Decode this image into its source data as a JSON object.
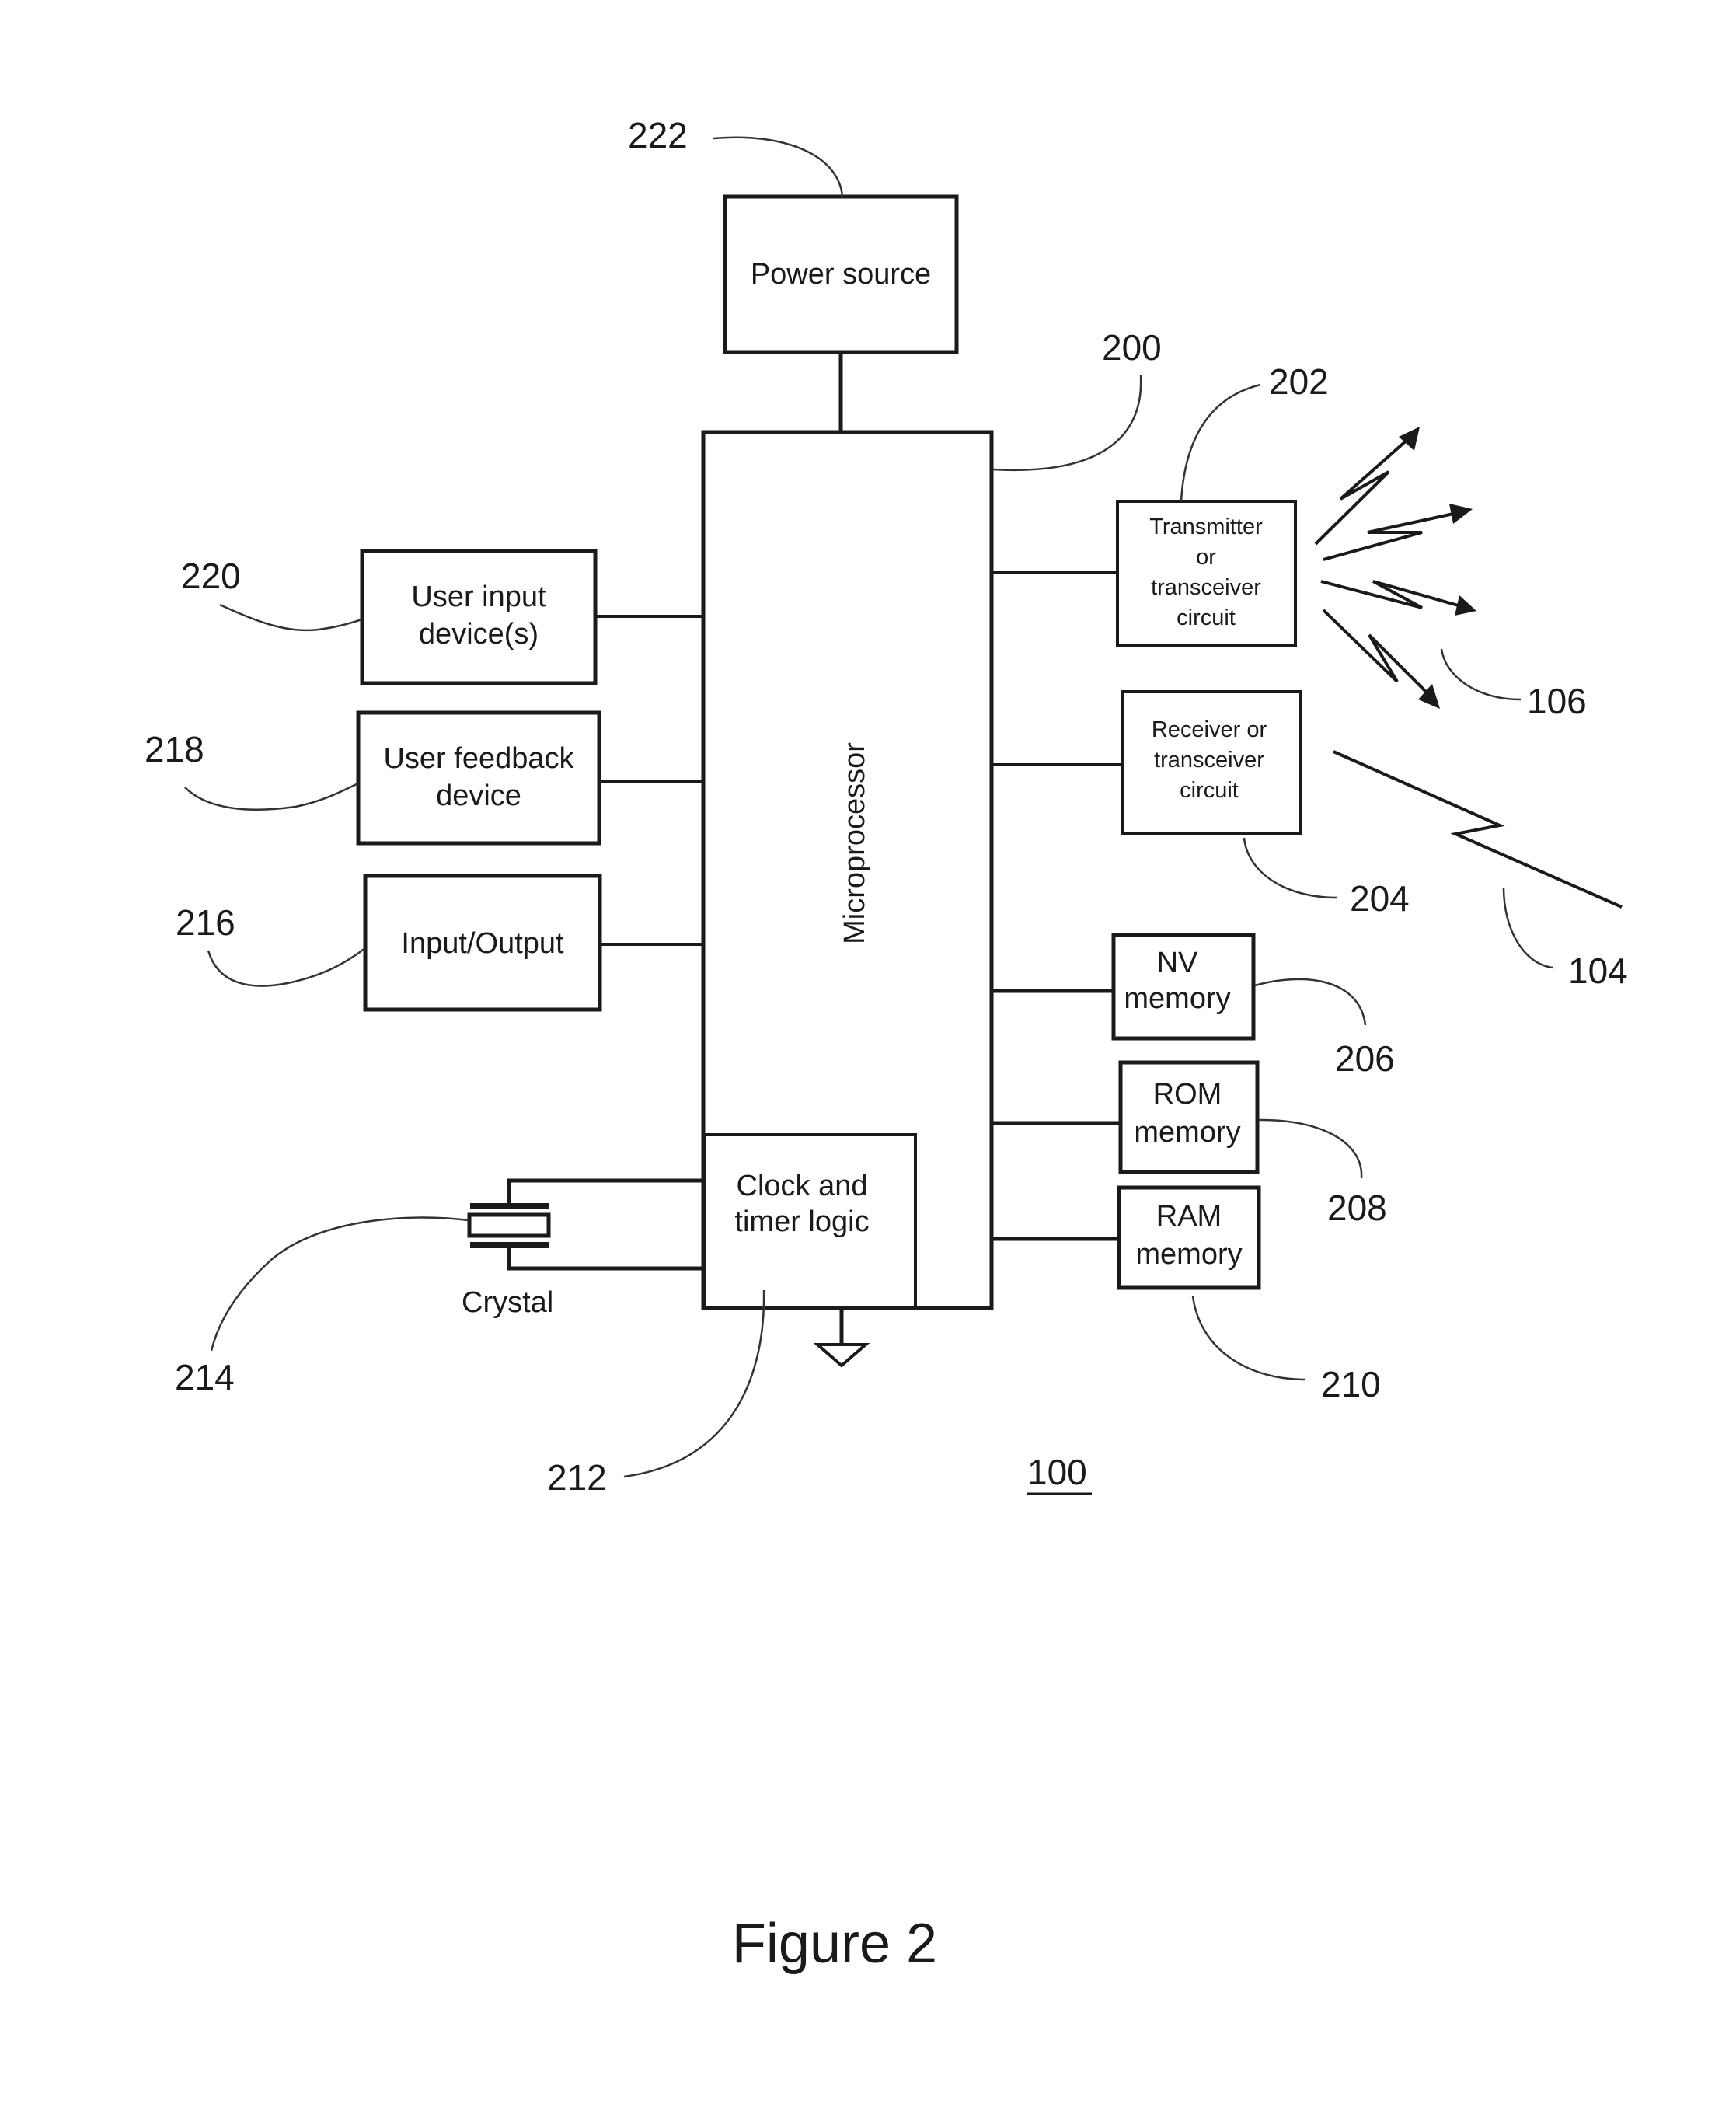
{
  "figure": {
    "caption": "Figure 2",
    "device_ref": "100"
  },
  "blocks": {
    "power_source": {
      "label": "Power source",
      "ref": "222"
    },
    "microprocessor": {
      "label": "Microprocessor",
      "ref": "200"
    },
    "clock_timer": {
      "lines": [
        "Clock and",
        "timer logic"
      ],
      "ref": "212"
    },
    "transmitter": {
      "lines": [
        "Transmitter",
        "or",
        "transceiver",
        "circuit"
      ],
      "ref": "202"
    },
    "receiver": {
      "lines": [
        "Receiver or",
        "transceiver",
        "circuit"
      ],
      "ref": "204"
    },
    "nv_memory": {
      "lines": [
        "NV",
        "memory"
      ],
      "ref": "206"
    },
    "rom_memory": {
      "lines": [
        "ROM",
        "memory"
      ],
      "ref": "208"
    },
    "ram_memory": {
      "lines": [
        "RAM",
        "memory"
      ],
      "ref": "210"
    },
    "user_input": {
      "lines": [
        "User input",
        "device(s)"
      ],
      "ref": "220"
    },
    "user_feedback": {
      "lines": [
        "User feedback",
        "device"
      ],
      "ref": "218"
    },
    "input_output": {
      "label": "Input/Output",
      "ref": "216"
    },
    "crystal": {
      "label": "Crystal",
      "ref": "214"
    }
  },
  "signals": {
    "transmitted": {
      "ref": "106",
      "arrow_count": 4
    },
    "received": {
      "ref": "104"
    }
  },
  "colors": {
    "ink": "#1a1a1a",
    "background": "#ffffff"
  }
}
